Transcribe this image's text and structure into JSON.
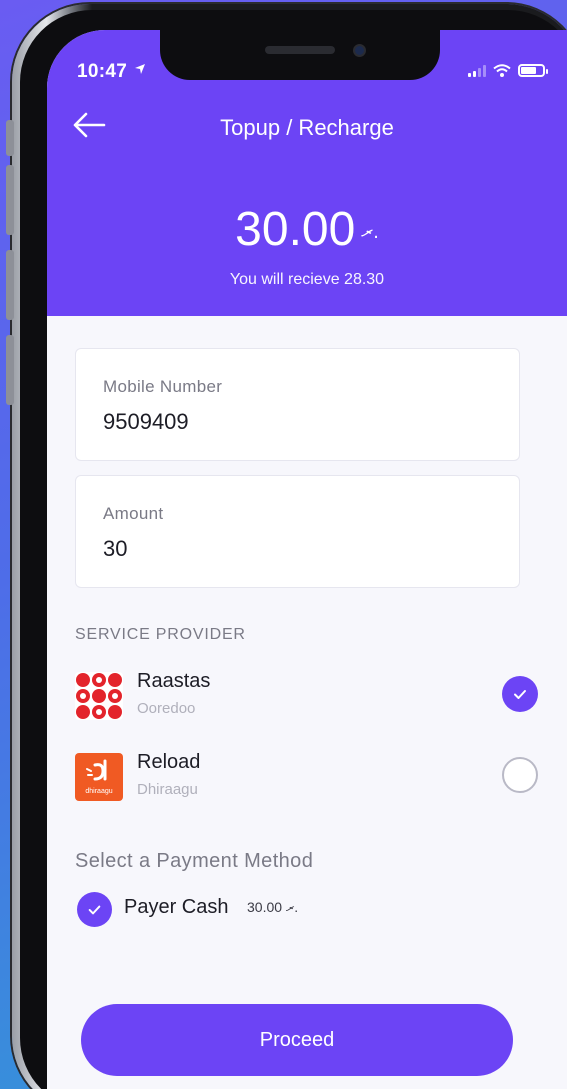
{
  "status_bar": {
    "time": "10:47"
  },
  "header": {
    "title": "Topup / Recharge",
    "amount": "30.00",
    "currency_symbol": "ރ.",
    "receive_text": "You will recieve 28.30"
  },
  "form": {
    "mobile": {
      "label": "Mobile Number",
      "value": "9509409"
    },
    "amount": {
      "label": "Amount",
      "value": "30"
    }
  },
  "service_provider": {
    "label": "SERVICE PROVIDER",
    "providers": [
      {
        "name": "Raastas",
        "sub": "Ooredoo",
        "selected": true,
        "logo_color": "#e3242b"
      },
      {
        "name": "Reload",
        "sub": "Dhiraagu",
        "selected": false,
        "logo_color": "#f05a23",
        "logo_text": "dhiraagu"
      }
    ]
  },
  "payment": {
    "label": "Select a Payment Method",
    "method": "Payer Cash",
    "amount": "30.00",
    "currency_symbol": "ރ."
  },
  "proceed_label": "Proceed",
  "colors": {
    "accent": "#6c44f5",
    "background": "#f7f7fc"
  },
  "icons": {
    "back": "arrow-left-icon",
    "check": "check-icon"
  }
}
